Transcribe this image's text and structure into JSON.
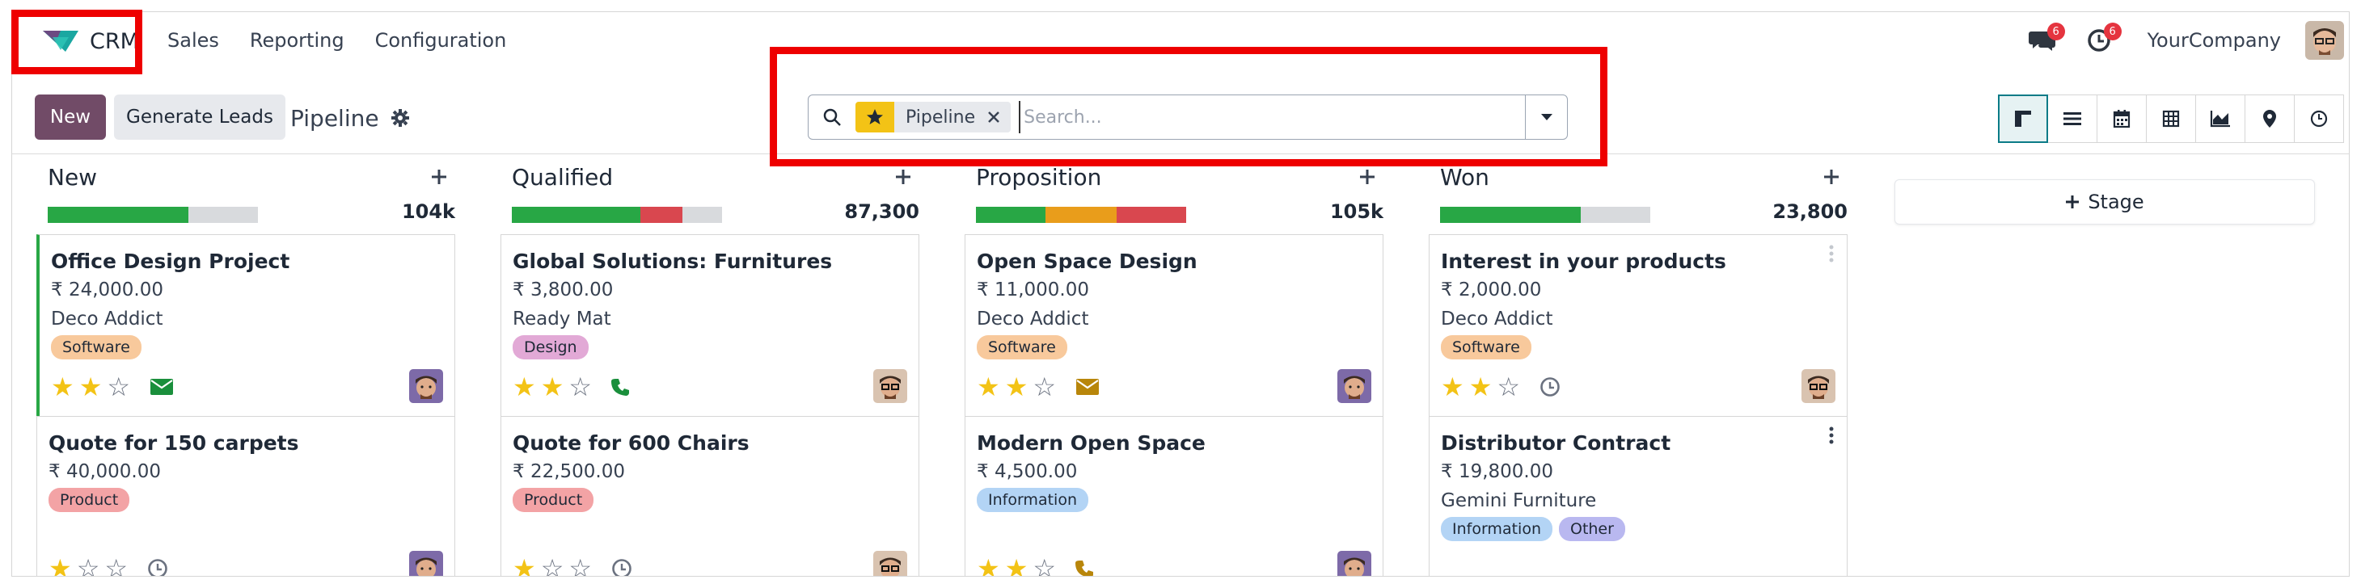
{
  "navbar": {
    "app_name": "CRM",
    "menu": [
      "Sales",
      "Reporting",
      "Configuration"
    ],
    "messages_badge": "6",
    "activities_badge": "6",
    "company": "YourCompany"
  },
  "control": {
    "new_label": "New",
    "generate_label": "Generate Leads",
    "breadcrumb": "Pipeline",
    "search": {
      "facet_label": "Pipeline",
      "placeholder": "Search..."
    },
    "views": [
      "kanban-icon",
      "list-icon",
      "calendar-icon",
      "pivot-icon",
      "graph-icon",
      "map-pin-icon",
      "activity-clock-icon"
    ]
  },
  "kanban": {
    "add_stage_label": "Stage",
    "columns": [
      {
        "title": "New",
        "total": "104k",
        "progress": [
          {
            "color": "#28a745",
            "fraction": 0.67
          }
        ],
        "cards": [
          {
            "title": "Office Design Project",
            "amount": "₹ 24,000.00",
            "customer": "Deco Addict",
            "tags": [
              {
                "label": "Software",
                "bg": "#f8c99c"
              }
            ],
            "stars": 2,
            "activity": "email-icon",
            "activity_color": "#1a8f3c",
            "accent": true
          },
          {
            "title": "Quote for 150 carpets",
            "amount": "₹ 40,000.00",
            "customer": "",
            "tags": [
              {
                "label": "Product",
                "bg": "#f3a3a5"
              }
            ],
            "stars": 1,
            "activity": "clock-icon",
            "activity_color": "#6b7280",
            "accent": false
          }
        ]
      },
      {
        "title": "Qualified",
        "total": "87,300",
        "progress": [
          {
            "color": "#28a745",
            "fraction": 0.61
          },
          {
            "color": "#d9474f",
            "fraction": 0.2
          }
        ],
        "cards": [
          {
            "title": "Global Solutions: Furnitures",
            "amount": "₹ 3,800.00",
            "customer": "Ready Mat",
            "tags": [
              {
                "label": "Design",
                "bg": "#e2a9d6"
              }
            ],
            "stars": 2,
            "activity": "phone-icon",
            "activity_color": "#1a8f3c",
            "accent": false
          },
          {
            "title": "Quote for 600 Chairs",
            "amount": "₹ 22,500.00",
            "customer": "",
            "tags": [
              {
                "label": "Product",
                "bg": "#f3a3a5"
              }
            ],
            "stars": 1,
            "activity": "clock-icon",
            "activity_color": "#6b7280",
            "accent": false
          }
        ]
      },
      {
        "title": "Proposition",
        "total": "105k",
        "progress": [
          {
            "color": "#28a745",
            "fraction": 0.33
          },
          {
            "color": "#e99d1b",
            "fraction": 0.34
          },
          {
            "color": "#d9474f",
            "fraction": 0.33
          }
        ],
        "cards": [
          {
            "title": "Open Space Design",
            "amount": "₹ 11,000.00",
            "customer": "Deco Addict",
            "tags": [
              {
                "label": "Software",
                "bg": "#f8c99c"
              }
            ],
            "stars": 2,
            "activity": "email-icon",
            "activity_color": "#b8860b",
            "accent": false
          },
          {
            "title": "Modern Open Space",
            "amount": "₹ 4,500.00",
            "customer": "",
            "tags": [
              {
                "label": "Information",
                "bg": "#b3d4f5"
              }
            ],
            "stars": 2,
            "activity": "phone-icon",
            "activity_color": "#b8860b",
            "accent": false
          }
        ]
      },
      {
        "title": "Won",
        "total": "23,800",
        "progress": [
          {
            "color": "#28a745",
            "fraction": 0.67
          }
        ],
        "cards": [
          {
            "title": "Interest in your products",
            "amount": "₹ 2,000.00",
            "customer": "Deco Addict",
            "tags": [
              {
                "label": "Software",
                "bg": "#f8c99c"
              }
            ],
            "stars": 2,
            "activity": "clock-icon",
            "activity_color": "#6b7280",
            "accent": false
          },
          {
            "title": "Distributor Contract",
            "amount": "₹ 19,800.00",
            "customer": "Gemini Furniture",
            "tags": [
              {
                "label": "Information",
                "bg": "#b3d4f5"
              },
              {
                "label": "Other",
                "bg": "#b9b8f0"
              }
            ],
            "stars": 0,
            "activity": "",
            "activity_color": "#6b7280",
            "accent": false
          }
        ]
      }
    ]
  }
}
